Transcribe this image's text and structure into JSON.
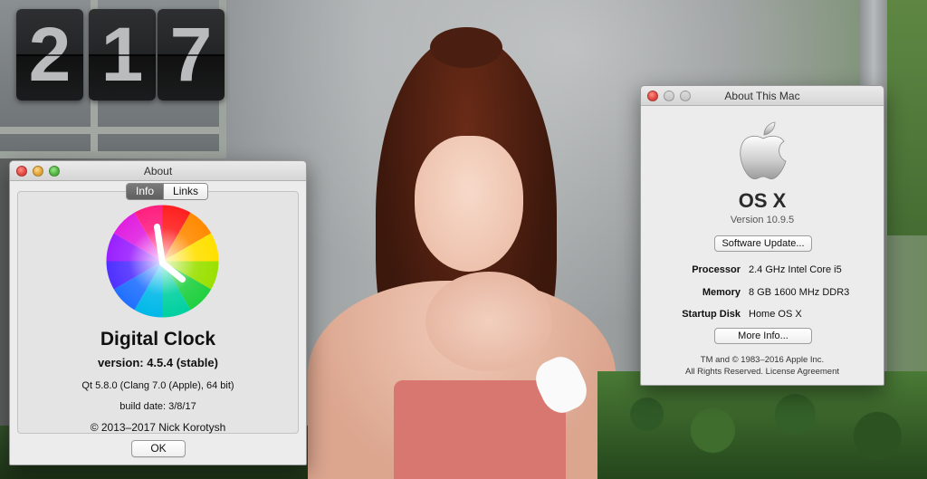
{
  "clock_widget": {
    "digits": [
      "2",
      "1",
      "7"
    ]
  },
  "digital_clock_about": {
    "window_title": "About",
    "tabs": [
      {
        "label": "Info",
        "active": true
      },
      {
        "label": "Links",
        "active": false
      }
    ],
    "app_name": "Digital Clock",
    "version": "version: 4.5.4 (stable)",
    "qt_info": "Qt 5.8.0 (Clang 7.0 (Apple), 64 bit)",
    "build_date": "build date: 3/8/17",
    "copyright": "© 2013–2017 Nick Korotysh",
    "ok_label": "OK"
  },
  "about_this_mac": {
    "window_title": "About This Mac",
    "os_name": "OS X",
    "os_version": "Version 10.9.5",
    "software_update_label": "Software Update...",
    "specs": [
      {
        "key": "Processor",
        "value": "2.4 GHz Intel Core i5"
      },
      {
        "key": "Memory",
        "value": "8 GB 1600 MHz DDR3"
      },
      {
        "key": "Startup Disk",
        "value": "Home OS X"
      }
    ],
    "more_info_label": "More Info...",
    "legal_line1": "TM and © 1983–2016 Apple Inc.",
    "legal_line2": "All Rights Reserved.  License Agreement"
  },
  "colors": {
    "close": "#e0443e",
    "minimize": "#dea236",
    "zoom": "#4fb33e",
    "tab_active": "#6a6a6a",
    "window_bg": "#ececec"
  },
  "icons": [
    "close-icon",
    "minimize-icon",
    "zoom-icon",
    "apple-logo-icon",
    "color-wheel-clock-icon"
  ]
}
